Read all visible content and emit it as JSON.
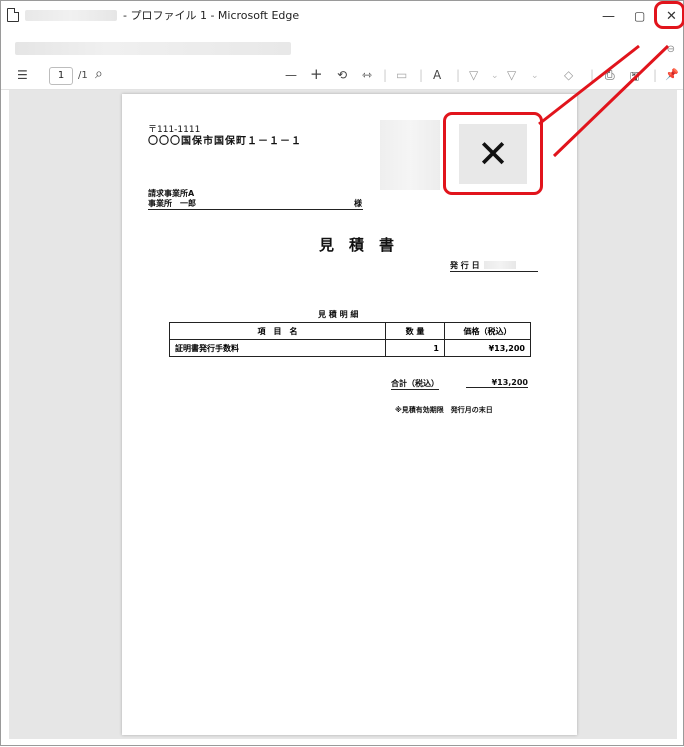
{
  "window": {
    "title_suffix": "- プロファイル 1 - Microsoft Edge",
    "minimize_glyph": "—",
    "maximize_glyph": "▢",
    "close_glyph": "✕"
  },
  "toolbar": {
    "contents_glyph": "☰",
    "page_current": "1",
    "page_total": "/1",
    "search_glyph": "⌕",
    "zoom_out_glyph": "—",
    "zoom_in_glyph": "+",
    "rotate_glyph": "⟲",
    "fit_glyph": "⇿",
    "page_view_glyph": "▭",
    "read_aloud_glyph": "A",
    "draw_glyph": "▽",
    "highlight_glyph": "▽",
    "erase_glyph": "◇",
    "print_glyph": "⎙",
    "save_glyph": "🖫",
    "pin_glyph": "📌"
  },
  "addressbar": {
    "zoom_glyph": "⊖"
  },
  "document": {
    "postal": "〒111-1111",
    "address": "〇〇〇国保市国保町１－１－１",
    "recipient_company": "請求事業所A",
    "recipient_person": "事業所　一郎",
    "honorific": "様",
    "title": "見　積　書",
    "issue_date_label": "発 行 日",
    "table_title": "見 積 明 細",
    "headers": [
      "項　目　名",
      "数 量",
      "価格（税込）"
    ],
    "rows": [
      {
        "item": "証明書発行手数料",
        "qty": "1",
        "price": "¥13,200"
      }
    ],
    "total_label": "合計（税込）",
    "total_value": "¥13,200",
    "note": "※見積有効期限　発行月の末日"
  },
  "callout": {
    "glyph": "✕"
  }
}
